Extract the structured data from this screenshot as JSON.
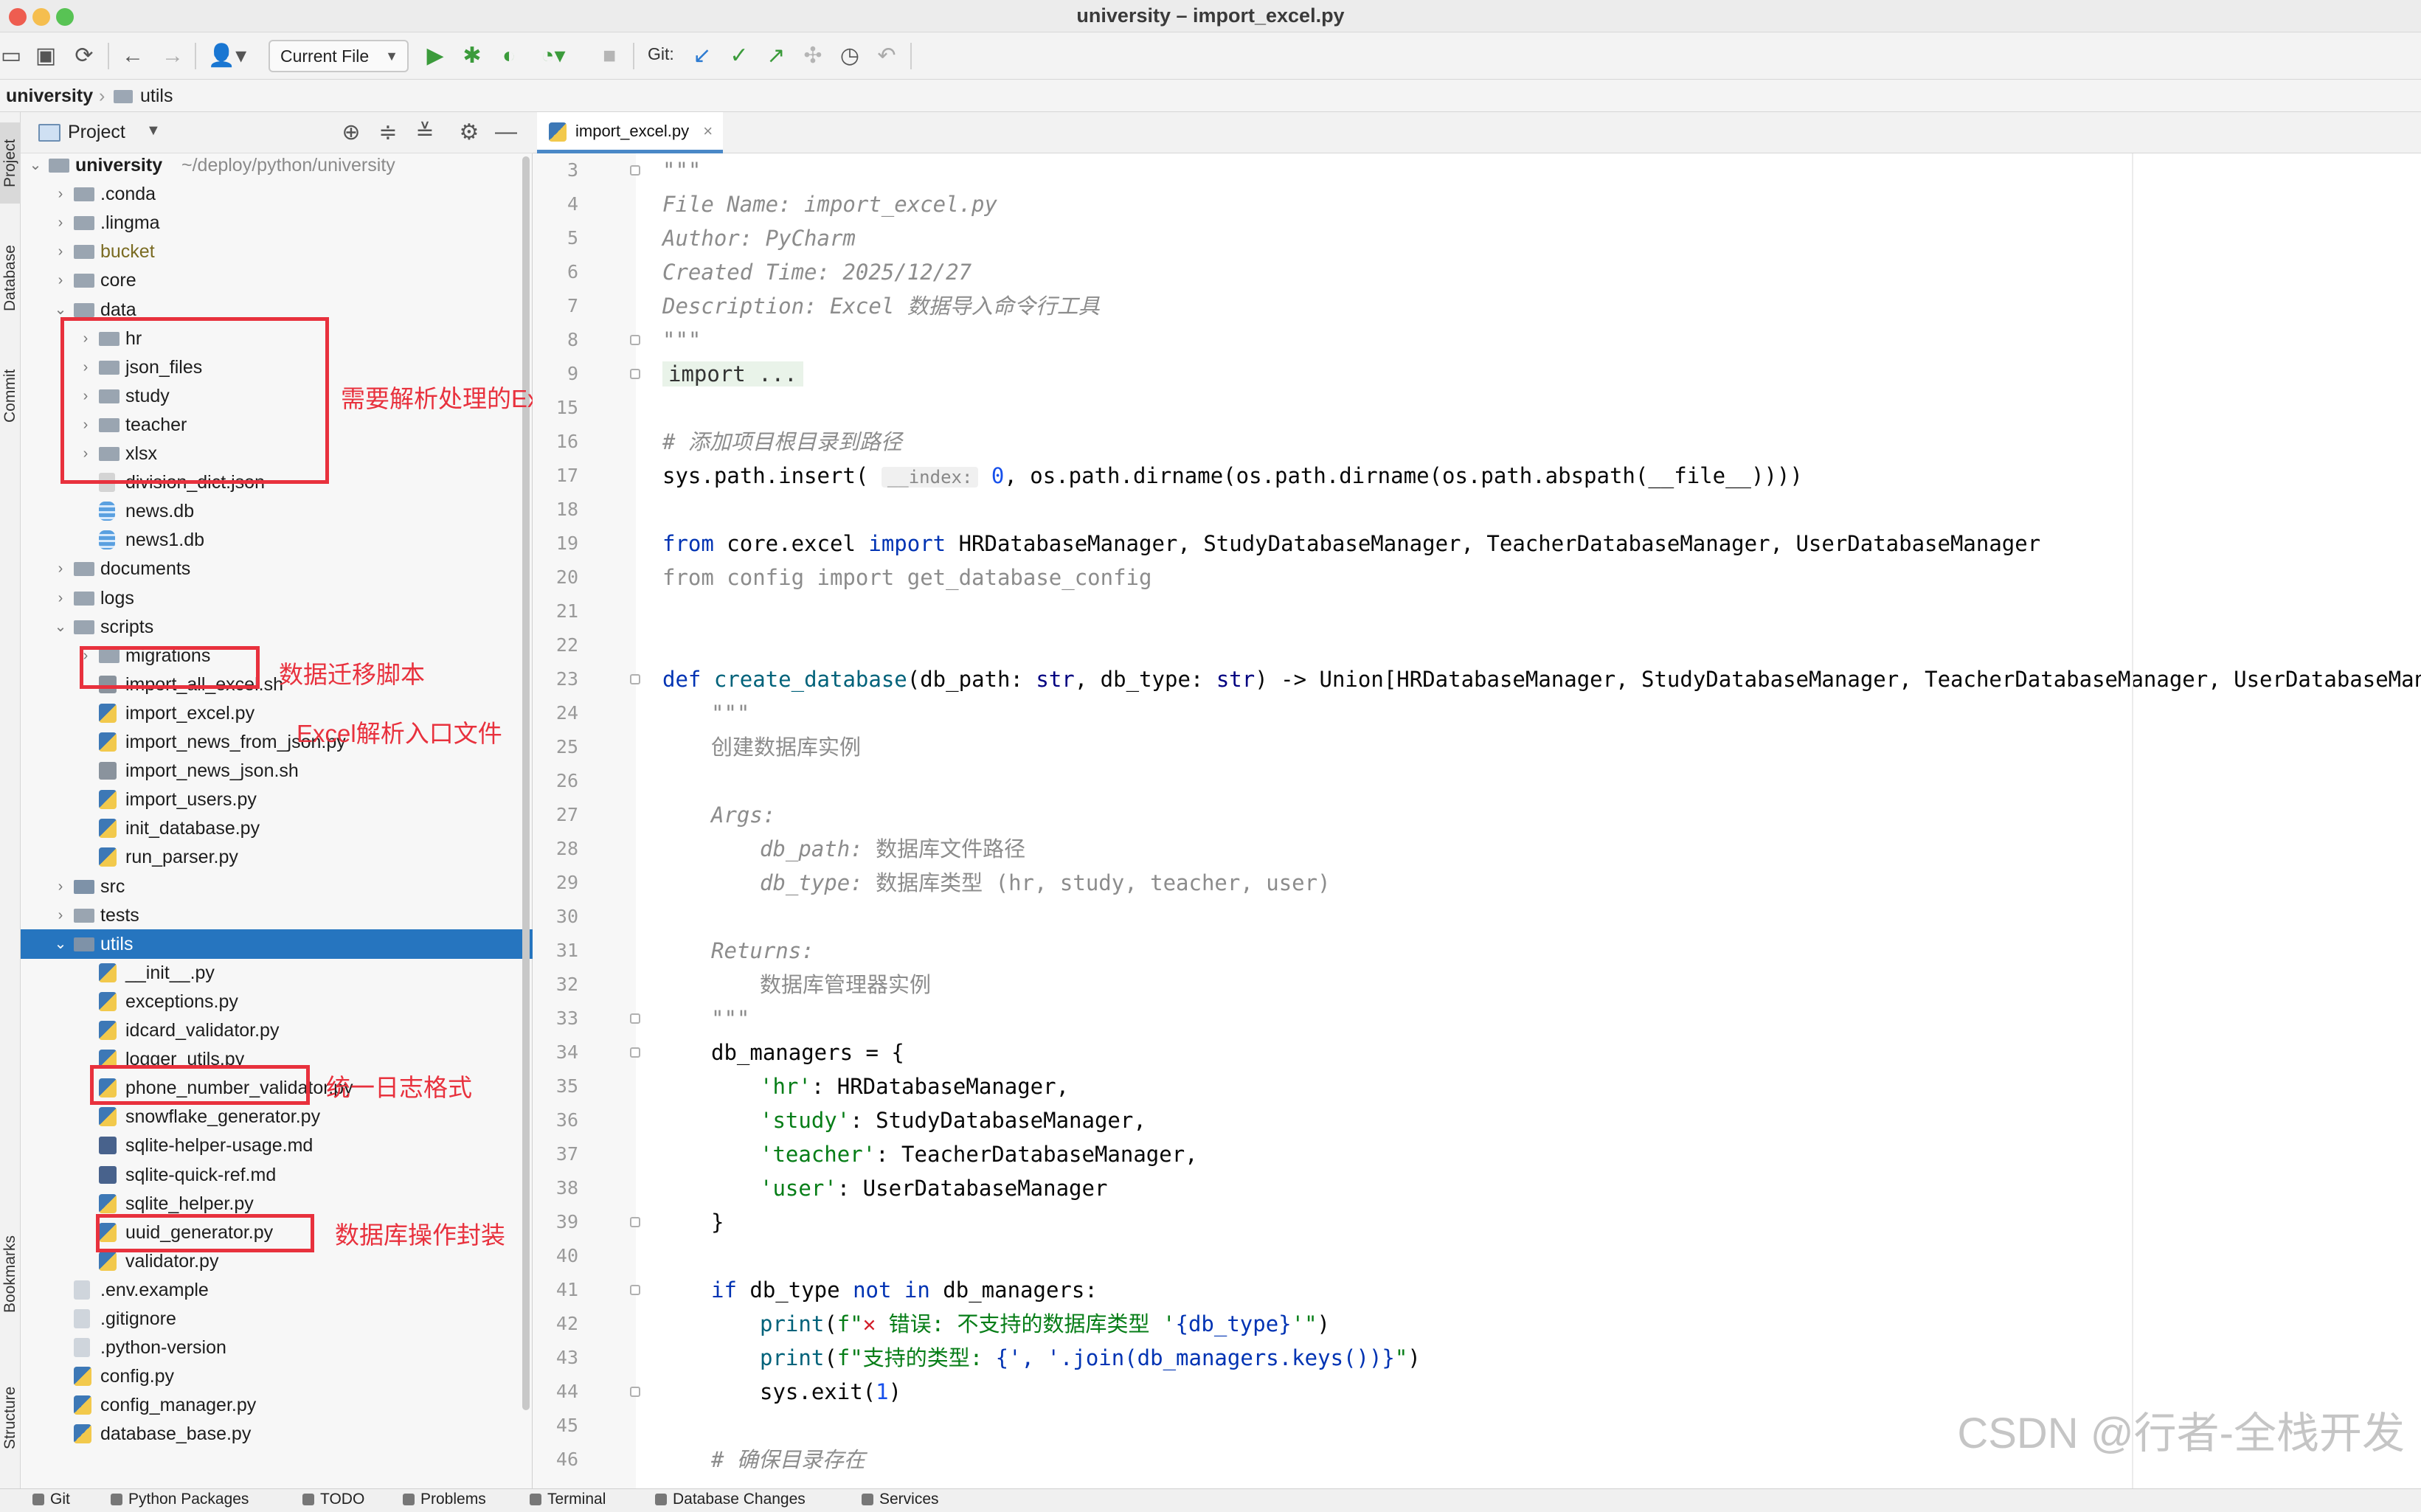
{
  "window": {
    "title": "university – import_excel.py"
  },
  "toolbar": {
    "run_config": "Current File",
    "git_label": "Git:"
  },
  "breadcrumb": {
    "root": "university",
    "separator": "›",
    "child": "utils"
  },
  "left_strip": {
    "tabs": [
      "Project",
      "Database",
      "Commit",
      "Bookmarks",
      "Structure"
    ]
  },
  "project_panel": {
    "title": "Project",
    "tree": [
      {
        "label": "university",
        "sub": "~/deploy/python/university",
        "icon": "folder-icon",
        "expanded": true,
        "bold": true
      },
      {
        "label": ".conda",
        "icon": "folder-icon"
      },
      {
        "label": ".lingma",
        "icon": "folder-icon"
      },
      {
        "label": "bucket",
        "icon": "folder-icon"
      },
      {
        "label": "core",
        "icon": "folder-icon"
      },
      {
        "label": "data",
        "icon": "folder-icon",
        "expanded": true
      },
      {
        "label": "hr",
        "icon": "folder-icon"
      },
      {
        "label": "json_files",
        "icon": "folder-icon"
      },
      {
        "label": "study",
        "icon": "folder-icon"
      },
      {
        "label": "teacher",
        "icon": "folder-icon"
      },
      {
        "label": "xlsx",
        "icon": "folder-icon"
      },
      {
        "label": "division_dict.json",
        "icon": "json-file-icon"
      },
      {
        "label": "news.db",
        "icon": "database-file-icon"
      },
      {
        "label": "news1.db",
        "icon": "database-file-icon"
      },
      {
        "label": "documents",
        "icon": "folder-icon"
      },
      {
        "label": "logs",
        "icon": "folder-icon"
      },
      {
        "label": "scripts",
        "icon": "folder-icon",
        "expanded": true
      },
      {
        "label": "migrations",
        "icon": "folder-icon"
      },
      {
        "label": "import_all_excel.sh",
        "icon": "shell-file-icon"
      },
      {
        "label": "import_excel.py",
        "icon": "python-file-icon"
      },
      {
        "label": "import_news_from_json.py",
        "icon": "python-file-icon"
      },
      {
        "label": "import_news_json.sh",
        "icon": "shell-file-icon"
      },
      {
        "label": "import_users.py",
        "icon": "python-file-icon"
      },
      {
        "label": "init_database.py",
        "icon": "python-file-icon"
      },
      {
        "label": "run_parser.py",
        "icon": "python-file-icon"
      },
      {
        "label": "src",
        "icon": "folder-icon"
      },
      {
        "label": "tests",
        "icon": "folder-icon"
      },
      {
        "label": "utils",
        "icon": "folder-icon",
        "expanded": true,
        "selected": true
      },
      {
        "label": "__init__.py",
        "icon": "python-file-icon"
      },
      {
        "label": "exceptions.py",
        "icon": "python-file-icon"
      },
      {
        "label": "idcard_validator.py",
        "icon": "python-file-icon"
      },
      {
        "label": "logger_utils.py",
        "icon": "python-file-icon"
      },
      {
        "label": "phone_number_validator.py",
        "icon": "python-file-icon"
      },
      {
        "label": "snowflake_generator.py",
        "icon": "python-file-icon"
      },
      {
        "label": "sqlite-helper-usage.md",
        "icon": "markdown-file-icon"
      },
      {
        "label": "sqlite-quick-ref.md",
        "icon": "markdown-file-icon"
      },
      {
        "label": "sqlite_helper.py",
        "icon": "python-file-icon"
      },
      {
        "label": "uuid_generator.py",
        "icon": "python-file-icon"
      },
      {
        "label": "validator.py",
        "icon": "python-file-icon"
      },
      {
        "label": ".env.example",
        "icon": "text-file-icon"
      },
      {
        "label": ".gitignore",
        "icon": "text-file-icon"
      },
      {
        "label": ".python-version",
        "icon": "text-file-icon"
      },
      {
        "label": "config.py",
        "icon": "python-file-icon"
      },
      {
        "label": "config_manager.py",
        "icon": "python-file-icon"
      },
      {
        "label": "database_base.py",
        "icon": "python-file-icon"
      }
    ]
  },
  "annotations": {
    "data_folders": "需要解析处理的Excel文件",
    "migrations": "数据迁移脚本",
    "import_excel": "Excel解析入口文件",
    "logger": "统一日志格式",
    "sqlite_helper": "数据库操作封装"
  },
  "editor": {
    "tab": "import_excel.py",
    "line_numbers": [
      "3",
      "4",
      "5",
      "6",
      "7",
      "8",
      "9",
      "15",
      "16",
      "17",
      "18",
      "19",
      "20",
      "21",
      "22",
      "23",
      "24",
      "25",
      "26",
      "27",
      "28",
      "29",
      "30",
      "31",
      "32",
      "33",
      "34",
      "35",
      "36",
      "37",
      "38",
      "39",
      "40",
      "41",
      "42",
      "43",
      "44",
      "45",
      "46"
    ],
    "code": {
      "l3": "\"\"\"",
      "l4": "File Name: import_excel.py",
      "l5": "Author: PyCharm",
      "l6": "Created Time: 2025/12/27",
      "l7": "Description: Excel 数据导入命令行工具",
      "l8": "\"\"\"",
      "l9": "import ...",
      "l16": "# 添加项目根目录到路径",
      "l17a": "sys.path.insert(",
      "l17hint": "__index:",
      "l17b": "0",
      "l17c": ", os.path.dirname(os.path.dirname(os.path.abspath(__file__))))",
      "l19a": "from",
      "l19b": " core.excel ",
      "l19c": "import",
      "l19d": " HRDatabaseManager, StudyDatabaseManager, TeacherDatabaseManager, UserDatabaseManager",
      "l20": "from config import get_database_config",
      "l23a": "def",
      "l23b": "create_database",
      "l23c": "(db_path: ",
      "l23d": "str",
      "l23e": ", db_type: ",
      "l23f": "str",
      "l23g": ") -> Union[HRDatabaseManager, StudyDatabaseManager, TeacherDatabaseManager, UserDatabaseManager]:",
      "l24": "\"\"\"",
      "l25": "创建数据库实例",
      "l27": "Args:",
      "l28a": "db_path:",
      "l28b": " 数据库文件路径",
      "l29a": "db_type:",
      "l29b": " 数据库类型 (hr, study, teacher, user)",
      "l31": "Returns:",
      "l32": "数据库管理器实例",
      "l33": "\"\"\"",
      "l34": "db_managers = {",
      "l35a": "'hr'",
      "l35b": ": HRDatabaseManager,",
      "l36a": "'study'",
      "l36b": ": StudyDatabaseManager,",
      "l37a": "'teacher'",
      "l37b": ": TeacherDatabaseManager,",
      "l38a": "'user'",
      "l38b": ": UserDatabaseManager",
      "l39": "}",
      "l41a": "if",
      "l41b": " db_type ",
      "l41c": "not in",
      "l41d": " db_managers:",
      "l42a": "print",
      "l42b": "(",
      "l42c": "f\"",
      "l42x": "✕",
      "l42d": " 错误: 不支持的数据库类型 '",
      "l42e": "{db_type}",
      "l42f": "'\"",
      "l42g": ")",
      "l43a": "print",
      "l43b": "(",
      "l43c": "f\"支持的类型: ",
      "l43d": "{', '.join(db_managers.keys())}",
      "l43e": "\"",
      "l43f": ")",
      "l44a": "sys.exit(",
      "l44b": "1",
      "l44c": ")",
      "l46": "# 确保目录存在"
    }
  },
  "watermark": "CSDN @行者-全栈开发",
  "bottom_tools": [
    "Git",
    "Python Packages",
    "TODO",
    "Problems",
    "Terminal",
    "Database Changes",
    "Services"
  ],
  "colors": {
    "selection": "#2675bf",
    "annotation": "#e8313d",
    "keyword": "#0033b3",
    "string": "#067d17"
  }
}
